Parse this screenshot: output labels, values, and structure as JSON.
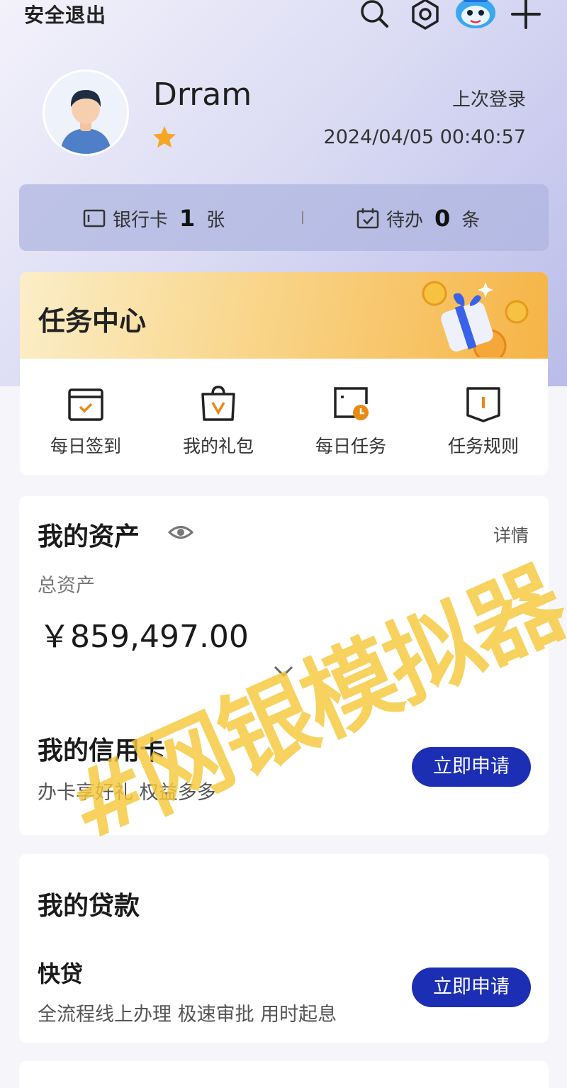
{
  "header": {
    "logout_label": "安全退出",
    "icons": [
      "search-icon",
      "settings-icon",
      "mascot-icon",
      "plus-icon"
    ]
  },
  "profile": {
    "username": "Drram",
    "level_stars": 1,
    "last_login_label": "上次登录",
    "last_login_time": "2024/04/05 00:40:57"
  },
  "summary": {
    "cards_label": "银行卡",
    "cards_count": "1",
    "cards_unit": "张",
    "todo_label": "待办",
    "todo_count": "0",
    "todo_unit": "条"
  },
  "task_center": {
    "title": "任务中心",
    "items": [
      {
        "label": "每日签到",
        "icon": "calendar-check-icon"
      },
      {
        "label": "我的礼包",
        "icon": "gift-bag-icon"
      },
      {
        "label": "每日任务",
        "icon": "task-clock-icon"
      },
      {
        "label": "任务规则",
        "icon": "rules-book-icon"
      }
    ]
  },
  "assets": {
    "title": "我的资产",
    "detail_label": "详情",
    "total_label": "总资产",
    "total_amount": "￥859,497.00"
  },
  "credit_card": {
    "title": "我的信用卡",
    "subtitle": "办卡享好礼 权益多多",
    "button": "立即申请"
  },
  "loan": {
    "title": "我的贷款",
    "product_name": "快贷",
    "product_desc": "全流程线上办理 极速审批 用时起息",
    "button": "立即申请"
  },
  "watermark": "#网银模拟器",
  "colors": {
    "accent": "#1c2fb4",
    "star": "#f5a623",
    "task_header": "#f6b446",
    "watermark": "#f5c83c"
  }
}
